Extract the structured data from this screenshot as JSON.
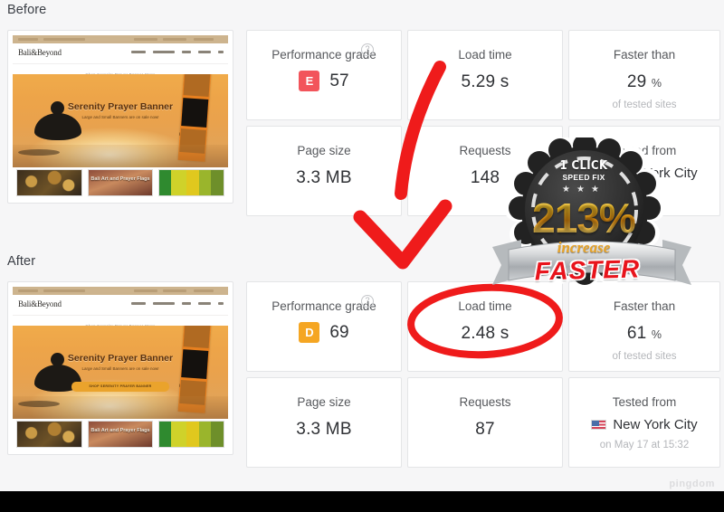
{
  "sections": {
    "before": {
      "label": "Before",
      "metrics": [
        {
          "name": "performance-grade",
          "title": "Performance grade",
          "grade_letter": "E",
          "grade_color": "#f2545b",
          "value": "57",
          "help": "?"
        },
        {
          "name": "load-time",
          "title": "Load time",
          "value": "5.29 s"
        },
        {
          "name": "faster-than",
          "title": "Faster than",
          "value": "29",
          "unit": "%",
          "sub": "of tested sites"
        },
        {
          "name": "page-size",
          "title": "Page size",
          "value": "3.3 MB"
        },
        {
          "name": "requests",
          "title": "Requests",
          "value": "148"
        },
        {
          "name": "tested-from",
          "title": "Tested from",
          "city": "New York City",
          "sub": "",
          "flag": "us-flag-icon"
        }
      ]
    },
    "after": {
      "label": "After",
      "metrics": [
        {
          "name": "performance-grade",
          "title": "Performance grade",
          "grade_letter": "D",
          "grade_color": "#f5a623",
          "value": "69",
          "help": "?"
        },
        {
          "name": "load-time",
          "title": "Load time",
          "value": "2.48 s"
        },
        {
          "name": "faster-than",
          "title": "Faster than",
          "value": "61",
          "unit": "%",
          "sub": "of tested sites"
        },
        {
          "name": "page-size",
          "title": "Page size",
          "value": "3.3 MB"
        },
        {
          "name": "requests",
          "title": "Requests",
          "value": "87"
        },
        {
          "name": "tested-from",
          "title": "Tested from",
          "city": "New York City",
          "sub": "on May 17 at 15:32",
          "flag": "us-flag-icon"
        }
      ]
    }
  },
  "screenshot": {
    "site_logo": "Bali&Beyond",
    "tagline": "Shop Serenity Prayer Banner Store",
    "hero_title": "Serenity Prayer Banner",
    "hero_sub": "Large and Small Banners are on sale now!",
    "hero_cta": "SHOP SERENITY PRAYER BANNER",
    "thumb_caption": "Bali Art and Prayer Flags"
  },
  "badge": {
    "top_line": "1 CLICK",
    "second_line": "SPEED FIX",
    "stars": "★★★",
    "percent": "213%",
    "increase": "increase",
    "ribbon": "FASTER"
  },
  "watermark": "pingdom",
  "colors": {
    "grade_e": "#f2545b",
    "grade_d": "#f5a623",
    "annotation_red": "#ef1b1b",
    "badge_gold": "#e8a41f",
    "page_bg": "#f6f6f7"
  }
}
